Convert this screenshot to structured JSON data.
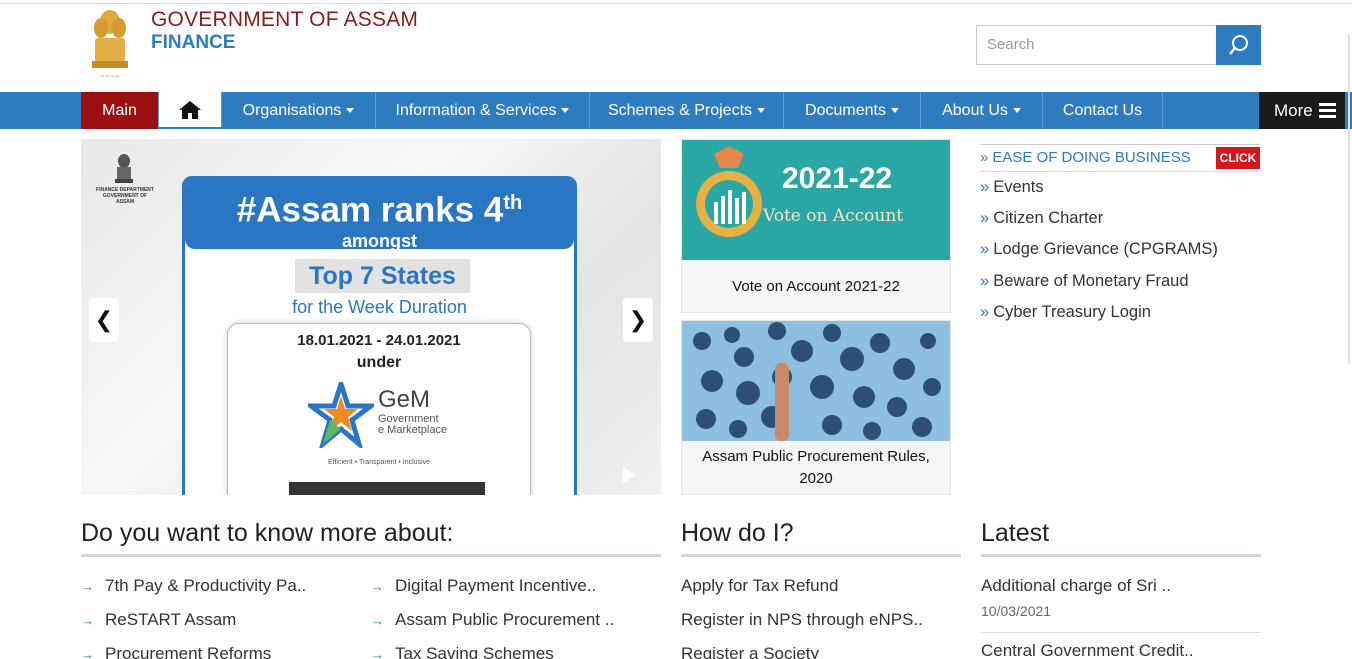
{
  "header": {
    "gov_title": "GOVERNMENT OF ASSAM",
    "dept_title": "FINANCE",
    "search_placeholder": "Search"
  },
  "nav": {
    "main": "Main",
    "items": [
      "Organisations",
      "Information & Services",
      "Schemes & Projects",
      "Documents",
      "About Us",
      "Contact Us"
    ],
    "more": "More"
  },
  "slider": {
    "dept_line1": "FINANCE DEPARTMENT",
    "dept_line2": "GOVERNMENT OF ASSAM",
    "headline": "#Assam ranks 4",
    "headline_sup": "th",
    "amongst": "amongst",
    "top7": "Top 7 States",
    "week": "for the Week Duration",
    "dates": "18.01.2021 - 24.01.2021",
    "under": "under",
    "gem_name": "GeM",
    "gem_sub1": "Government",
    "gem_sub2": "e Marketplace",
    "gem_tagline": "Efficient • Transparent • Inclusive"
  },
  "tiles": [
    {
      "year": "2021-22",
      "subtitle": "Vote on Account",
      "caption": "Vote on Account 2021-22"
    },
    {
      "caption_line1": "Assam Public Procurement Rules,",
      "caption_line2": "2020"
    }
  ],
  "quick_links": {
    "ease": "EASE OF DOING BUSINESS",
    "click": "CLICK",
    "items": [
      "Events",
      "Citizen Charter",
      "Lodge Grievance (CPGRAMS)",
      "Beware of Monetary Fraud",
      "Cyber Treasury Login"
    ]
  },
  "know_more": {
    "title": "Do you want to know more about:",
    "col1": [
      "7th Pay & Productivity Pa..",
      "ReSTART Assam",
      "Procurement Reforms"
    ],
    "col2": [
      "Digital Payment Incentive..",
      "Assam Public Procurement ..",
      "Tax Saving Schemes"
    ]
  },
  "how_do_i": {
    "title": "How do I?",
    "items": [
      "Apply for Tax Refund",
      "Register in NPS through eNPS..",
      "Register a Society"
    ]
  },
  "latest": {
    "title": "Latest",
    "items": [
      {
        "text": "Additional charge of Sri ..",
        "date": "10/03/2021"
      },
      {
        "text": "Central Government Credit.."
      }
    ]
  },
  "colors": {
    "nav_blue": "#2f7bbf",
    "main_red": "#9a1010",
    "title_red": "#8b1c1c",
    "click_red": "#d6141b",
    "tile_teal": "#2aa7a5"
  }
}
